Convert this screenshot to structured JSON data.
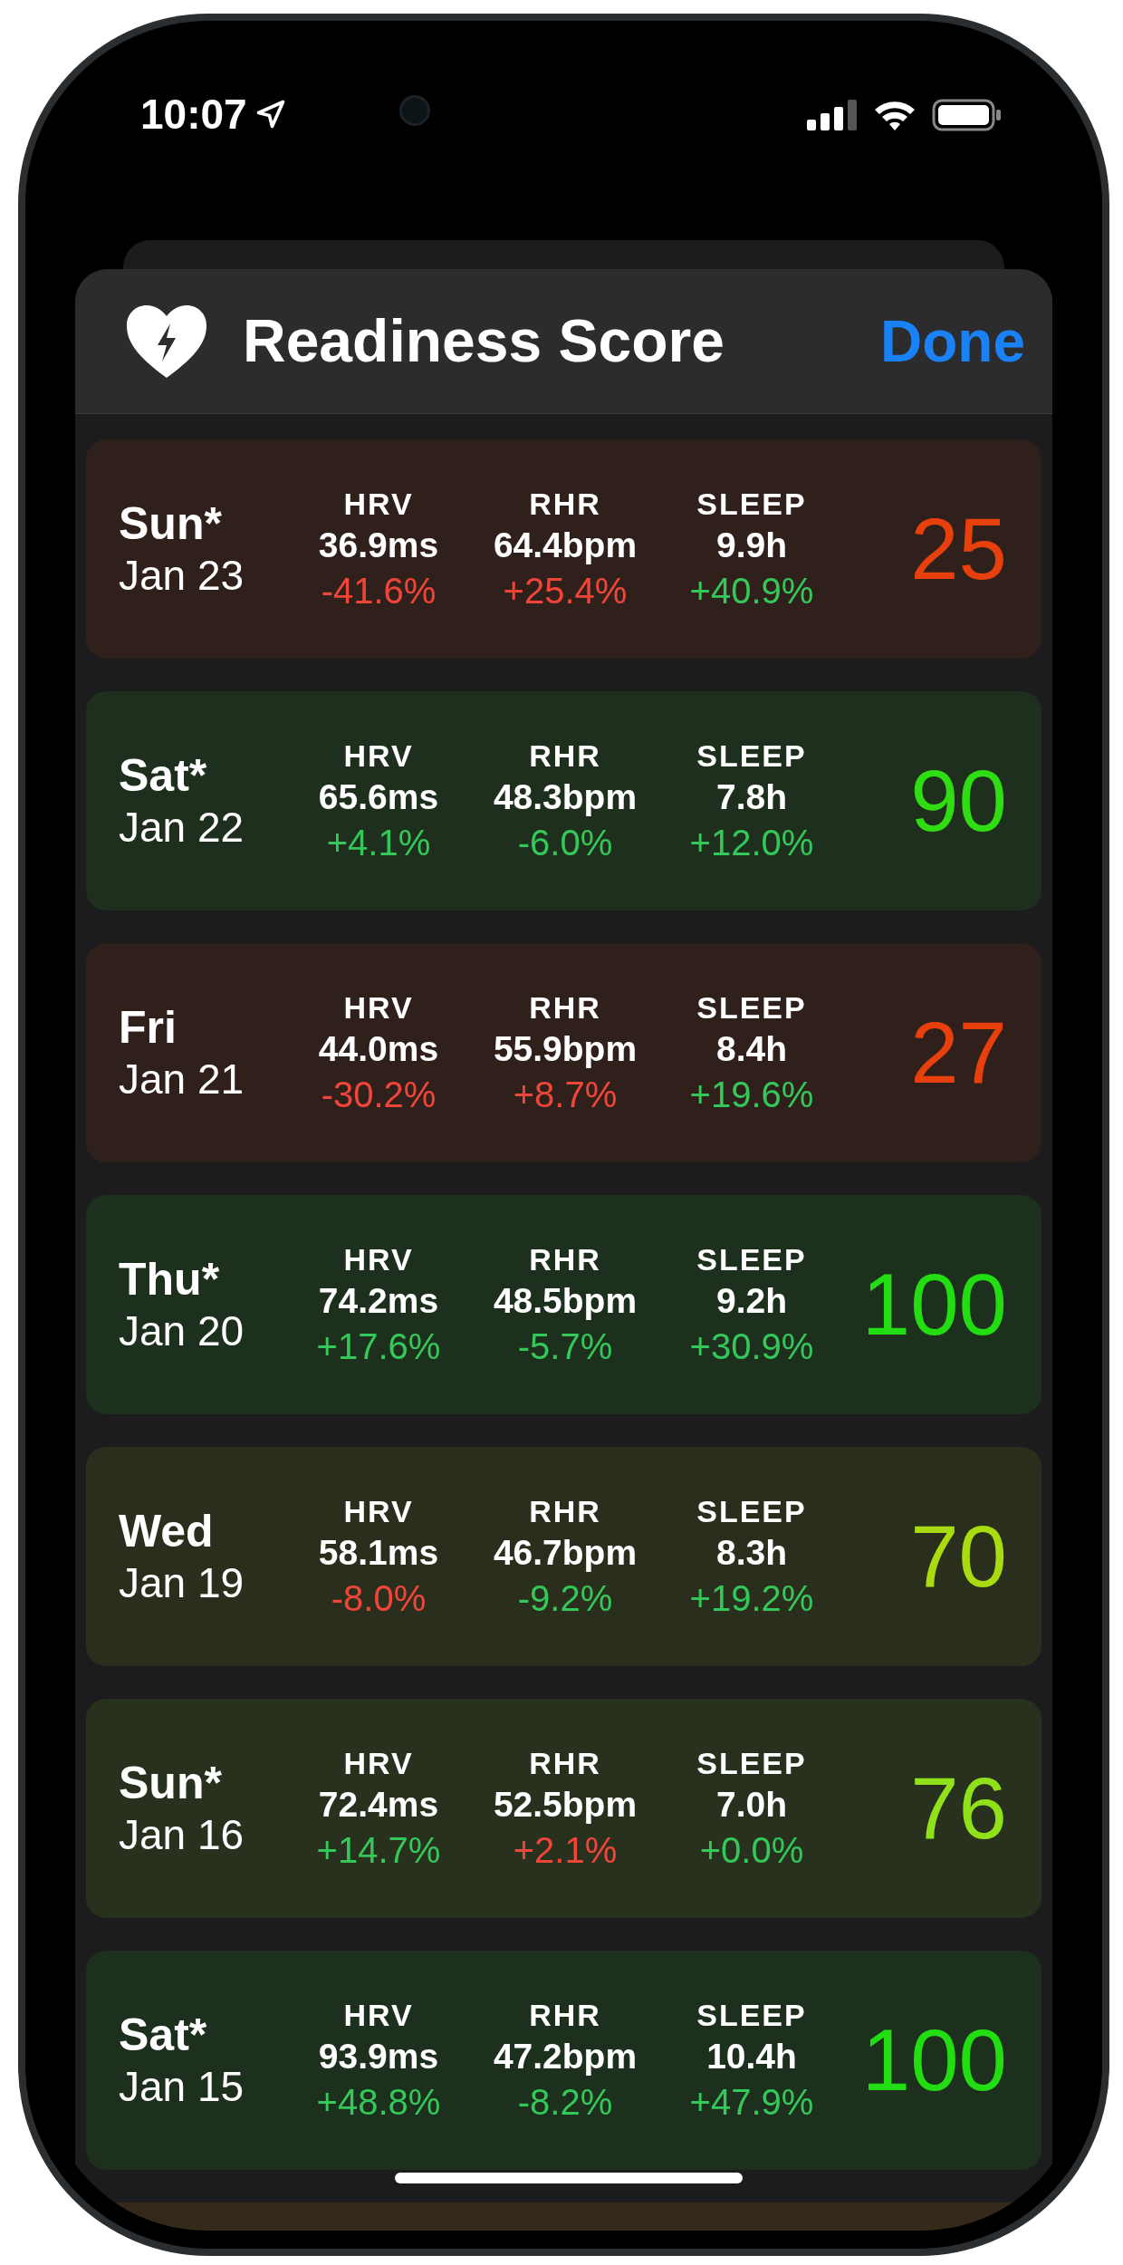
{
  "status_bar": {
    "time": "10:07"
  },
  "header": {
    "title": "Readiness Score",
    "done": "Done"
  },
  "days": [
    {
      "day": "Sun*",
      "date": "Jan 23",
      "score": "25",
      "color": "#e8400c",
      "metrics": [
        {
          "label": "HRV",
          "value": "36.9ms",
          "change": "-41.6%",
          "good": false
        },
        {
          "label": "RHR",
          "value": "64.4bpm",
          "change": "+25.4%",
          "good": false
        },
        {
          "label": "SLEEP",
          "value": "9.9h",
          "change": "+40.9%",
          "good": true
        }
      ]
    },
    {
      "day": "Sat*",
      "date": "Jan 22",
      "score": "90",
      "color": "#30dc12",
      "metrics": [
        {
          "label": "HRV",
          "value": "65.6ms",
          "change": "+4.1%",
          "good": true
        },
        {
          "label": "RHR",
          "value": "48.3bpm",
          "change": "-6.0%",
          "good": true
        },
        {
          "label": "SLEEP",
          "value": "7.8h",
          "change": "+12.0%",
          "good": true
        }
      ]
    },
    {
      "day": "Fri",
      "date": "Jan 21",
      "score": "27",
      "color": "#e8400c",
      "metrics": [
        {
          "label": "HRV",
          "value": "44.0ms",
          "change": "-30.2%",
          "good": false
        },
        {
          "label": "RHR",
          "value": "55.9bpm",
          "change": "+8.7%",
          "good": false
        },
        {
          "label": "SLEEP",
          "value": "8.4h",
          "change": "+19.6%",
          "good": true
        }
      ]
    },
    {
      "day": "Thu*",
      "date": "Jan 20",
      "score": "100",
      "color": "#22dd11",
      "metrics": [
        {
          "label": "HRV",
          "value": "74.2ms",
          "change": "+17.6%",
          "good": true
        },
        {
          "label": "RHR",
          "value": "48.5bpm",
          "change": "-5.7%",
          "good": true
        },
        {
          "label": "SLEEP",
          "value": "9.2h",
          "change": "+30.9%",
          "good": true
        }
      ]
    },
    {
      "day": "Wed",
      "date": "Jan 19",
      "score": "70",
      "color": "#a8dc10",
      "metrics": [
        {
          "label": "HRV",
          "value": "58.1ms",
          "change": "-8.0%",
          "good": false
        },
        {
          "label": "RHR",
          "value": "46.7bpm",
          "change": "-9.2%",
          "good": true
        },
        {
          "label": "SLEEP",
          "value": "8.3h",
          "change": "+19.2%",
          "good": true
        }
      ]
    },
    {
      "day": "Sun*",
      "date": "Jan 16",
      "score": "76",
      "color": "#90e01a",
      "metrics": [
        {
          "label": "HRV",
          "value": "72.4ms",
          "change": "+14.7%",
          "good": true
        },
        {
          "label": "RHR",
          "value": "52.5bpm",
          "change": "+2.1%",
          "good": false
        },
        {
          "label": "SLEEP",
          "value": "7.0h",
          "change": "+0.0%",
          "good": true
        }
      ]
    },
    {
      "day": "Sat*",
      "date": "Jan 15",
      "score": "100",
      "color": "#22dd11",
      "metrics": [
        {
          "label": "HRV",
          "value": "93.9ms",
          "change": "+48.8%",
          "good": true
        },
        {
          "label": "RHR",
          "value": "47.2bpm",
          "change": "-8.2%",
          "good": true
        },
        {
          "label": "SLEEP",
          "value": "10.4h",
          "change": "+47.9%",
          "good": true
        }
      ]
    }
  ]
}
